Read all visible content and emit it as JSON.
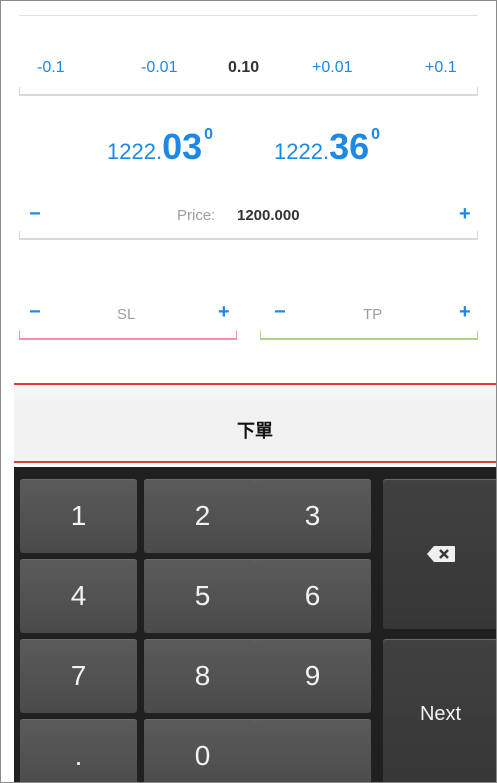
{
  "lot_steps": [
    "-0.1",
    "-0.01",
    "0.10",
    "+0.01",
    "+0.1"
  ],
  "quotes": {
    "sell": {
      "prefix": "1222.",
      "main": "03",
      "sup": "0"
    },
    "buy": {
      "prefix": "1222.",
      "main": "36",
      "sup": "0"
    }
  },
  "price": {
    "label": "Price:",
    "value": "1200.000",
    "minus": "−",
    "plus": "+"
  },
  "sl": {
    "label": "SL",
    "minus": "−",
    "plus": "+"
  },
  "tp": {
    "label": "TP",
    "minus": "−",
    "plus": "+"
  },
  "order_button": "下單",
  "keyboard": {
    "keys": [
      "1",
      "2",
      "3",
      "4",
      "5",
      "6",
      "7",
      "8",
      "9",
      ".",
      "0",
      ""
    ],
    "next": "Next"
  },
  "colors": {
    "accent": "#1e88e5",
    "sl_line": "#f48fb1",
    "tp_line": "#aed581",
    "order_line": "#e53935"
  }
}
